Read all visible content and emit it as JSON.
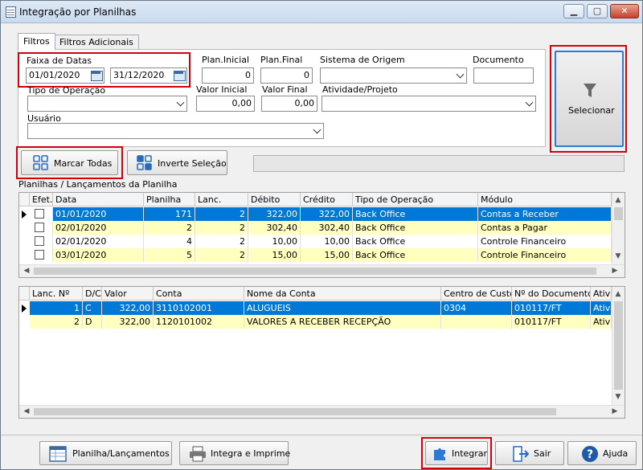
{
  "window": {
    "title": "Integração por Planilhas",
    "btn_min": "▁",
    "btn_max": "▢",
    "btn_close": "✕"
  },
  "tabs": [
    {
      "label": "Filtros"
    },
    {
      "label": "Filtros Adicionais"
    }
  ],
  "filters": {
    "faixa_label": "Faixa de Datas",
    "date_from": "01/01/2020",
    "date_to": "31/12/2020",
    "plan_inicial_label": "Plan.Inicial",
    "plan_inicial": "0",
    "plan_final_label": "Plan.Final",
    "plan_final": "0",
    "sistema_label": "Sistema de Origem",
    "sistema": "",
    "documento_label": "Documento",
    "documento": "",
    "tipo_op_label": "Tipo de Operação",
    "tipo_op": "",
    "valor_inicial_label": "Valor Inicial",
    "valor_inicial": "0,00",
    "valor_final_label": "Valor Final",
    "valor_final": "0,00",
    "atividade_label": "Atividade/Projeto",
    "atividade": "",
    "usuario_label": "Usuário",
    "usuario": ""
  },
  "selecionar_label": "Selecionar",
  "marcar_todas_label": "Marcar Todas",
  "inverte_label": "Inverte Seleção",
  "grid1": {
    "title": "Planilhas / Lançamentos da Planilha",
    "headers": [
      "Efet.",
      "Data",
      "Planilha",
      "Lanc.",
      "Débito",
      "Crédito",
      "Tipo de Operação",
      "Módulo"
    ],
    "rows": [
      {
        "data": "01/01/2020",
        "planilha": "171",
        "lanc": "2",
        "debito": "322,00",
        "credito": "322,00",
        "tipo": "Back Office",
        "modulo": "Contas a Receber"
      },
      {
        "data": "02/01/2020",
        "planilha": "2",
        "lanc": "2",
        "debito": "302,40",
        "credito": "302,40",
        "tipo": "Back Office",
        "modulo": "Contas a Pagar"
      },
      {
        "data": "02/01/2020",
        "planilha": "4",
        "lanc": "2",
        "debito": "10,00",
        "credito": "10,00",
        "tipo": "Back Office",
        "modulo": "Controle Financeiro"
      },
      {
        "data": "03/01/2020",
        "planilha": "5",
        "lanc": "2",
        "debito": "15,00",
        "credito": "15,00",
        "tipo": "Back Office",
        "modulo": "Controle Financeiro"
      }
    ]
  },
  "grid2": {
    "headers": [
      "Lanc. Nº",
      "D/C",
      "Valor",
      "Conta",
      "Nome da Conta",
      "Centro de Custo",
      "Nº do Documento",
      "Ativ"
    ],
    "rows": [
      {
        "lanc": "1",
        "dc": "C",
        "valor": "322,00",
        "conta": "3110102001",
        "nome": "ALUGUEIS",
        "centro": "0304",
        "doc": "010117/FT",
        "ativ": "Ativi"
      },
      {
        "lanc": "2",
        "dc": "D",
        "valor": "322,00",
        "conta": "1120101002",
        "nome": "VALORES A RECEBER RECEPÇÃO",
        "centro": "",
        "doc": "010117/FT",
        "ativ": "Ativi"
      }
    ]
  },
  "bottom": {
    "planilha": "Planilha/Lançamentos",
    "integra_imprime": "Integra e Imprime",
    "integrar": "Integrar",
    "sair": "Sair",
    "ajuda": "Ajuda"
  }
}
